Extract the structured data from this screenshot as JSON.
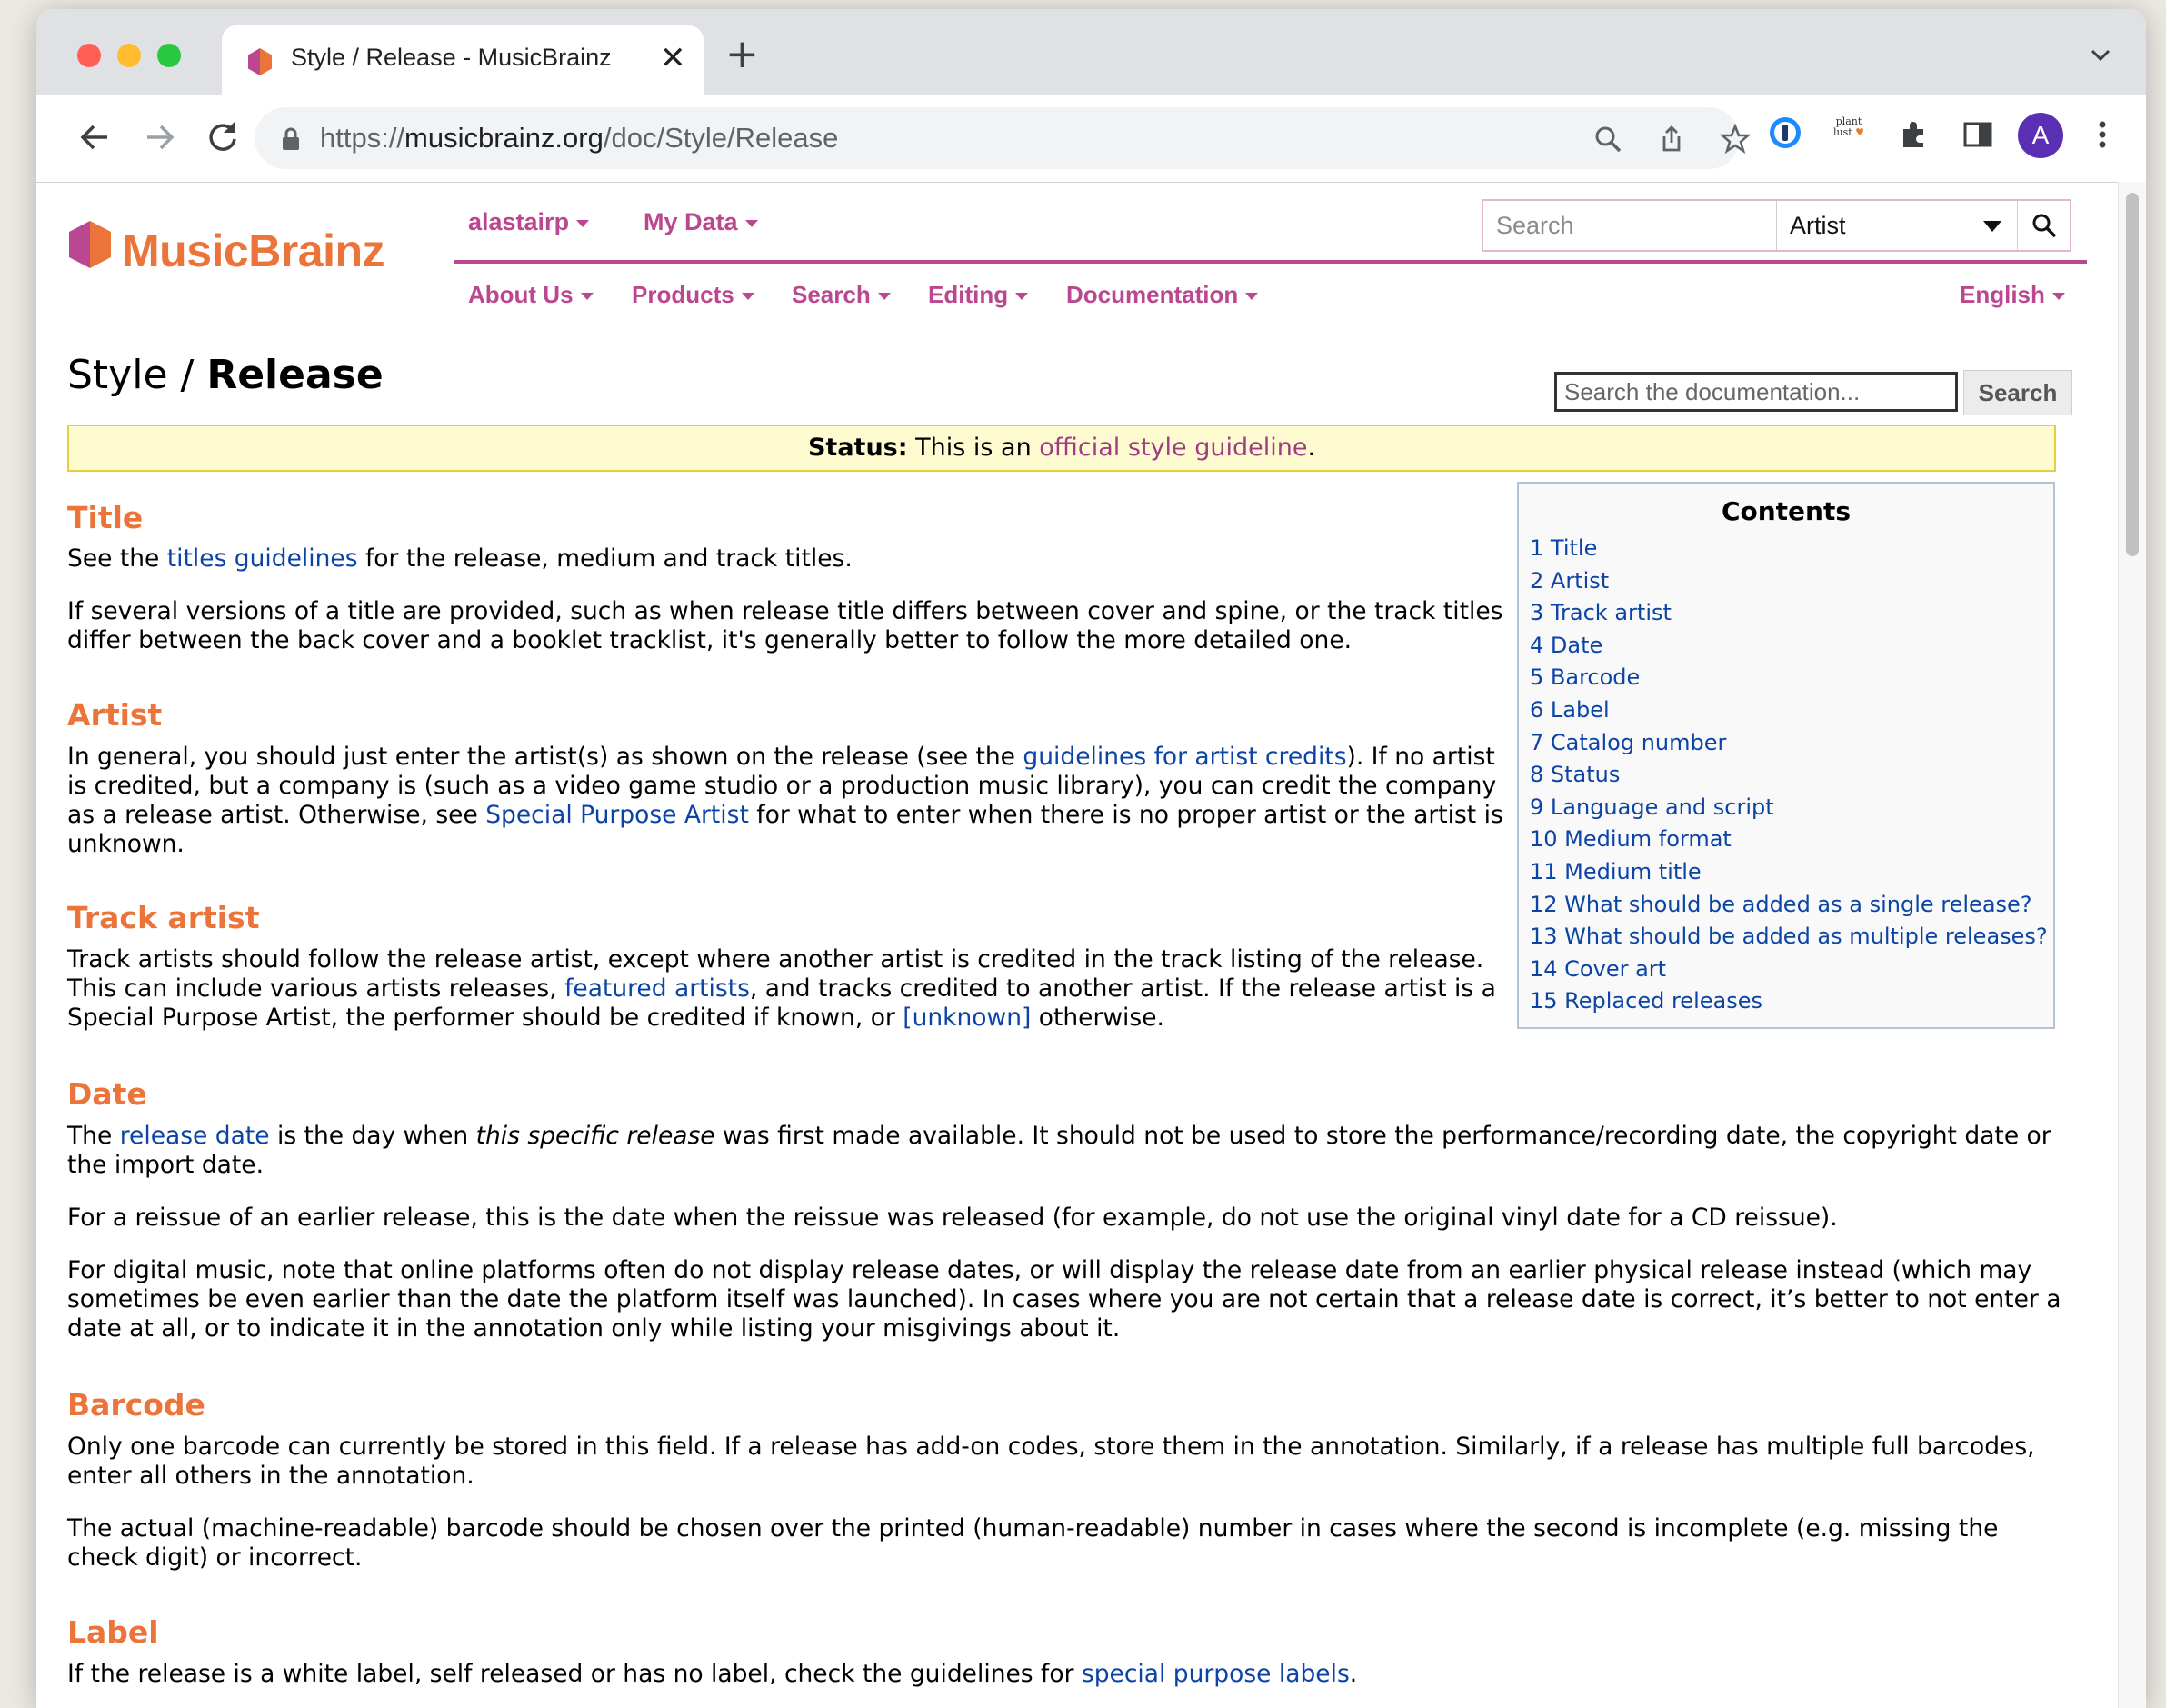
{
  "browser": {
    "tab_title": "Style / Release - MusicBrainz",
    "url_prefix": "https://",
    "url_host": "musicbrainz.org",
    "url_path": "/doc/Style/Release",
    "ext_plant_label": "plant lust"
  },
  "site": {
    "logo_text": "MusicBrainz",
    "user_menu": "alastairp",
    "my_data_menu": "My Data",
    "main_nav": [
      "About Us",
      "Products",
      "Search",
      "Editing",
      "Documentation"
    ],
    "language": "English",
    "search_placeholder": "Search",
    "search_type": "Artist"
  },
  "doc": {
    "title_prefix": "Style / ",
    "title_main": "Release",
    "search_placeholder": "Search the documentation...",
    "search_button": "Search",
    "status_label": "Status:",
    "status_text": " This is an ",
    "status_link": "official style guideline",
    "status_end": "."
  },
  "toc": {
    "title": "Contents",
    "items": [
      "1 Title",
      "2 Artist",
      "3 Track artist",
      "4 Date",
      "5 Barcode",
      "6 Label",
      "7 Catalog number",
      "8 Status",
      "9 Language and script",
      "10 Medium format",
      "11 Medium title",
      "12 What should be added as a single release?",
      "13 What should be added as multiple releases?",
      "14 Cover art",
      "15 Replaced releases"
    ]
  },
  "sections": {
    "title": {
      "heading": "Title",
      "p1_a": "See the ",
      "p1_link": "titles guidelines",
      "p1_b": " for the release, medium and track titles.",
      "p2": "If several versions of a title are provided, such as when release title differs between cover and spine, or the track titles differ between the back cover and a booklet tracklist, it's generally better to follow the more detailed one."
    },
    "artist": {
      "heading": "Artist",
      "a": "In general, you should just enter the artist(s) as shown on the release (see the ",
      "link1": "guidelines for artist credits",
      "b": "). If no artist is credited, but a company is (such as a video game studio or a production music library), you can credit the company as a release artist. Otherwise, see ",
      "link2": "Special Purpose Artist",
      "c": " for what to enter when there is no proper artist or the artist is unknown."
    },
    "track_artist": {
      "heading": "Track artist",
      "a": "Track artists should follow the release artist, except where another artist is credited in the track listing of the release. This can include various artists releases, ",
      "link1": "featured artists",
      "b": ", and tracks credited to another artist. If the release artist is a Special Purpose Artist, the performer should be credited if known, or ",
      "link2": "[unknown]",
      "c": " otherwise."
    },
    "date": {
      "heading": "Date",
      "p1_a": "The ",
      "p1_link": "release date",
      "p1_b": " is the day when ",
      "p1_em": "this specific release",
      "p1_c": " was first made available. It should not be used to store the performance/recording date, the copyright date or the import date.",
      "p2": "For a reissue of an earlier release, this is the date when the reissue was released (for example, do not use the original vinyl date for a CD reissue).",
      "p3": "For digital music, note that online platforms often do not display release dates, or will display the release date from an earlier physical release instead (which may sometimes be even earlier than the date the platform itself was launched). In cases where you are not certain that a release date is correct, it’s better to not enter a date at all, or to indicate it in the annotation only while listing your misgivings about it."
    },
    "barcode": {
      "heading": "Barcode",
      "p1": "Only one barcode can currently be stored in this field. If a release has add-on codes, store them in the annotation. Similarly, if a release has multiple full barcodes, enter all others in the annotation.",
      "p2": "The actual (machine-readable) barcode should be chosen over the printed (human-readable) number in cases where the second is incomplete (e.g. missing the check digit) or incorrect."
    },
    "label": {
      "heading": "Label",
      "p1_a": "If the release is a white label, self released or has no label, check the guidelines for ",
      "p1_link": "special purpose labels",
      "p1_b": "."
    }
  }
}
